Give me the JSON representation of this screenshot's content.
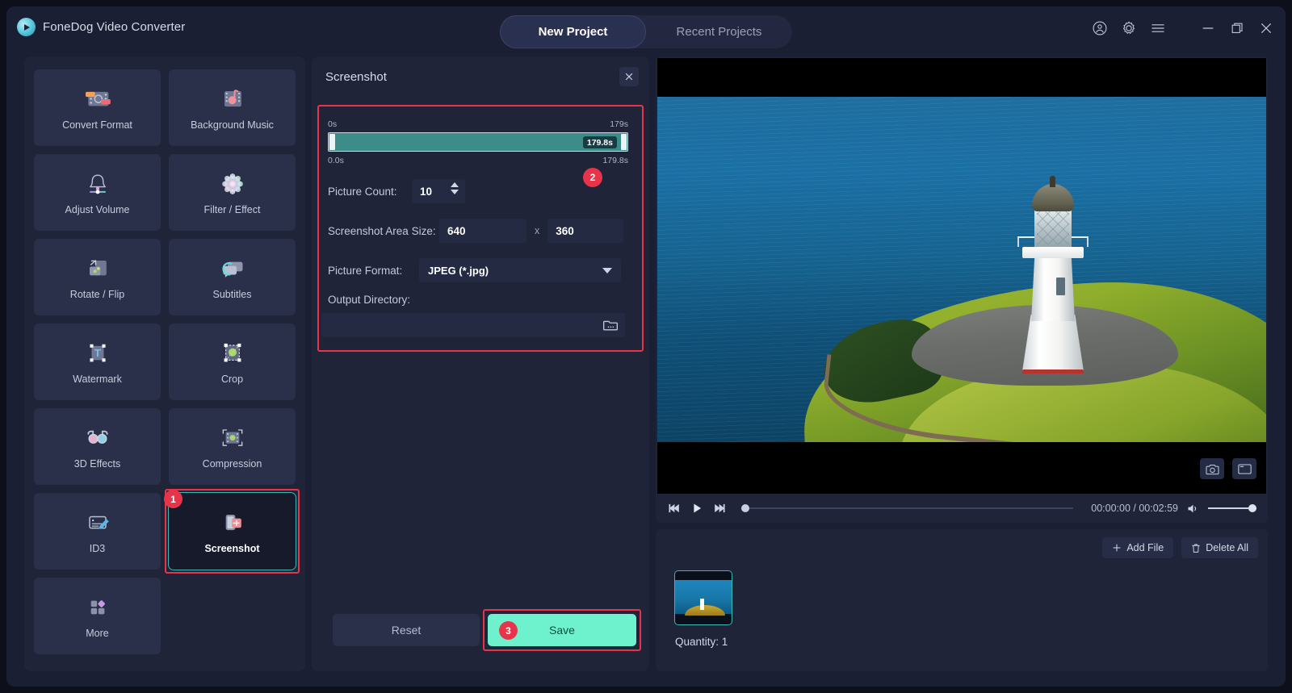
{
  "app": {
    "brand": "FoneDog Video Converter",
    "logo_icon": "play-circle-icon",
    "accent_teal": "#6df2cd",
    "accent_red": "#e8344a",
    "panel_bg": "#1f2438",
    "window_bg": "#1b1f33"
  },
  "titlebar": {
    "tabs": [
      {
        "label": "New Project",
        "active": true
      },
      {
        "label": "Recent Projects",
        "active": false
      }
    ],
    "icons": [
      {
        "name": "account-icon"
      },
      {
        "name": "gear-icon"
      },
      {
        "name": "menu-icon"
      },
      {
        "name": "minimize-icon"
      },
      {
        "name": "maximize-icon"
      },
      {
        "name": "close-icon"
      }
    ]
  },
  "sidebar": {
    "tools": [
      {
        "label": "Convert Format",
        "icon": "convert-format-icon",
        "selected": false
      },
      {
        "label": "Background Music",
        "icon": "background-music-icon",
        "selected": false
      },
      {
        "label": "Adjust Volume",
        "icon": "adjust-volume-icon",
        "selected": false
      },
      {
        "label": "Filter / Effect",
        "icon": "filter-effect-icon",
        "selected": false
      },
      {
        "label": "Rotate / Flip",
        "icon": "rotate-flip-icon",
        "selected": false
      },
      {
        "label": "Subtitles",
        "icon": "subtitles-icon",
        "selected": false
      },
      {
        "label": "Watermark",
        "icon": "watermark-icon",
        "selected": false
      },
      {
        "label": "Crop",
        "icon": "crop-icon",
        "selected": false
      },
      {
        "label": "3D Effects",
        "icon": "3d-effects-icon",
        "selected": false
      },
      {
        "label": "Compression",
        "icon": "compression-icon",
        "selected": false
      },
      {
        "label": "ID3",
        "icon": "id3-icon",
        "selected": false
      },
      {
        "label": "Screenshot",
        "icon": "screenshot-icon",
        "selected": true,
        "step_badge": "1"
      },
      {
        "label": "More",
        "icon": "more-icon",
        "selected": false
      }
    ]
  },
  "screenshot_panel": {
    "title": "Screenshot",
    "close_icon": "close-icon",
    "step_badge": "2",
    "timeline": {
      "top_left": "0s",
      "top_right": "179s",
      "bottom_left": "0.0s",
      "bottom_right": "179.8s",
      "chip": "179.8s",
      "range_start": 0,
      "range_end": 179.8
    },
    "fields": {
      "picture_count_label": "Picture Count:",
      "picture_count_value": "10",
      "area_size_label": "Screenshot Area Size:",
      "area_width": "640",
      "area_sep": "x",
      "area_height": "360",
      "picture_format_label": "Picture Format:",
      "picture_format_value": "JPEG (*.jpg)",
      "output_dir_label": "Output Directory:",
      "output_dir_value": "",
      "folder_icon": "folder-browse-icon"
    },
    "buttons": {
      "reset": "Reset",
      "save": "Save",
      "save_step_badge": "3"
    }
  },
  "preview": {
    "screenshot_tool_icon": "camera-icon",
    "fullscreen_tool_icon": "fullscreen-icon",
    "controls": {
      "prev_icon": "skip-previous-icon",
      "play_icon": "play-icon",
      "next_icon": "skip-next-icon",
      "time": "00:00:00 / 00:02:59",
      "volume_icon": "volume-icon"
    }
  },
  "filelist": {
    "add_file": "Add File",
    "add_file_icon": "plus-icon",
    "delete_all": "Delete All",
    "delete_all_icon": "trash-icon",
    "quantity": "Quantity: 1"
  }
}
